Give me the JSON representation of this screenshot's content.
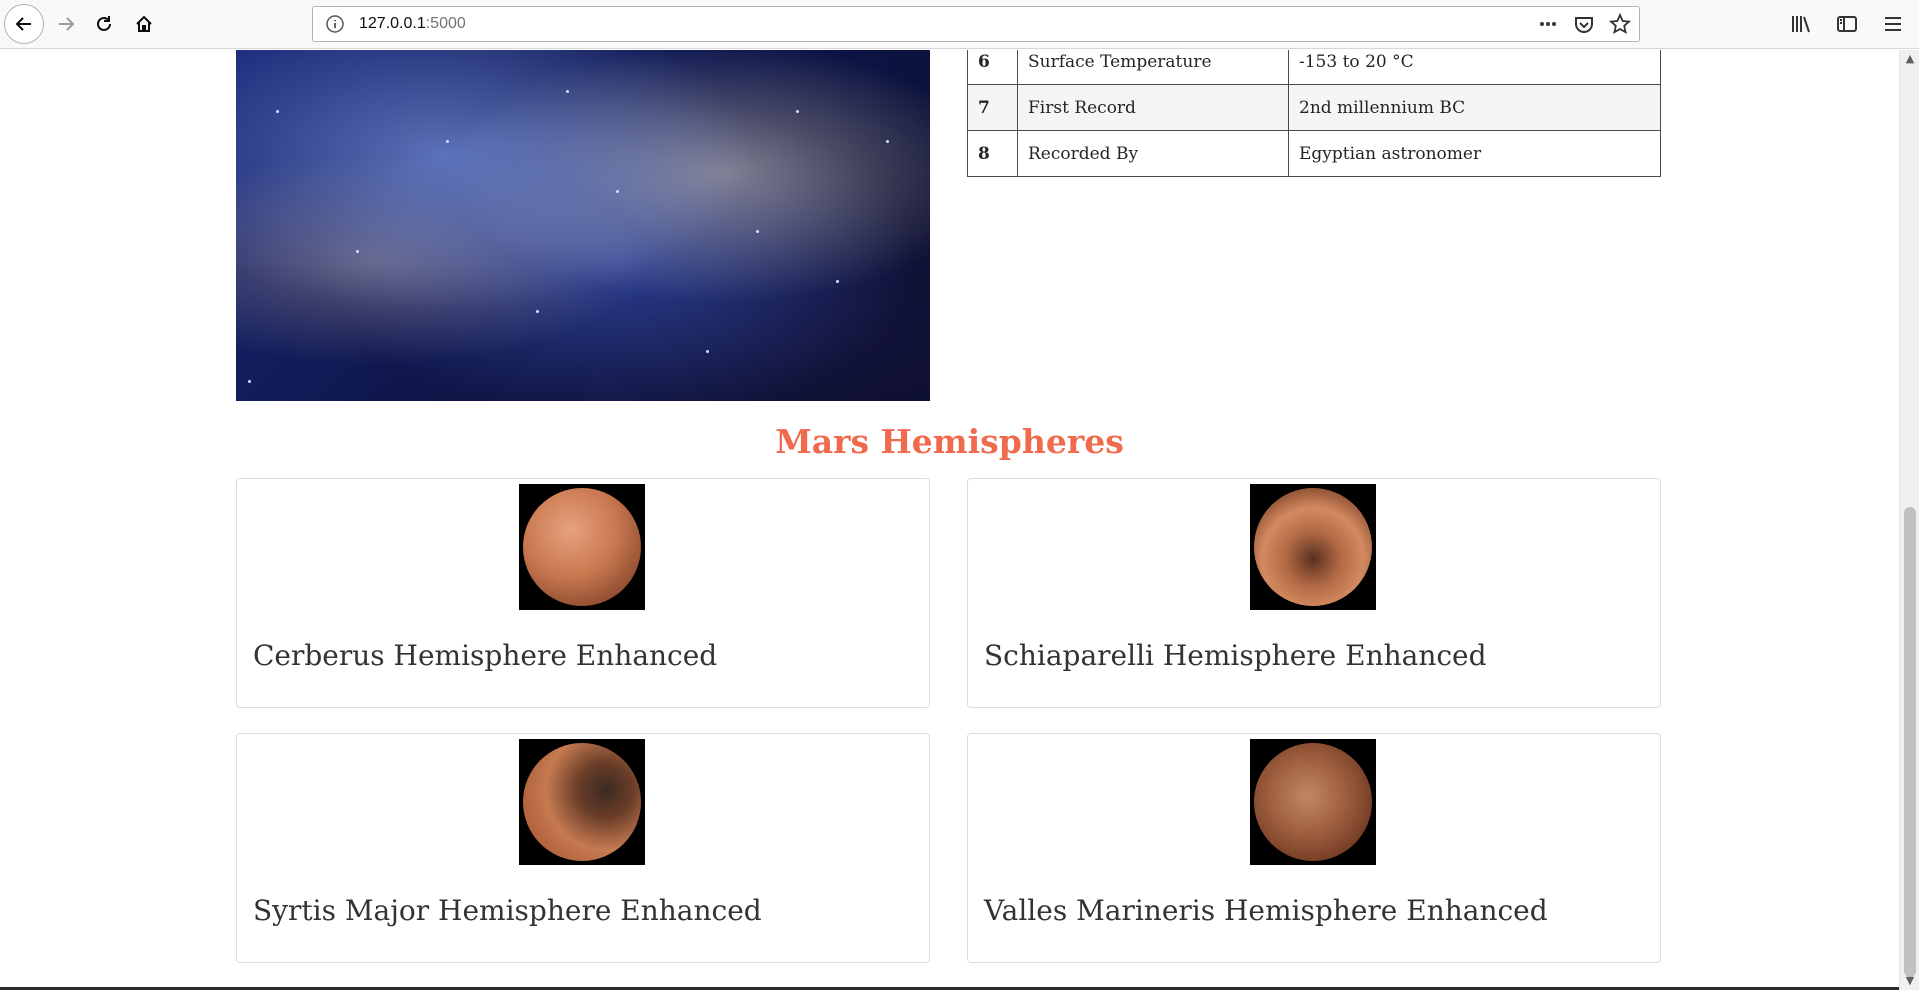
{
  "browser": {
    "url_host": "127.0.0.1",
    "url_port": ":5000"
  },
  "facts_table": {
    "rows": [
      {
        "index": "6",
        "key": "Surface Temperature",
        "value": "-153 to 20 °C"
      },
      {
        "index": "7",
        "key": "First Record",
        "value": "2nd millennium BC"
      },
      {
        "index": "8",
        "key": "Recorded By",
        "value": "Egyptian astronomer"
      }
    ]
  },
  "hemispheres": {
    "title": "Mars Hemispheres",
    "items": [
      {
        "title": "Cerberus Hemisphere Enhanced"
      },
      {
        "title": "Schiaparelli Hemisphere Enhanced"
      },
      {
        "title": "Syrtis Major Hemisphere Enhanced"
      },
      {
        "title": "Valles Marineris Hemisphere Enhanced"
      }
    ]
  },
  "colors": {
    "accent_title": "#f06a4e",
    "planet": "#c9784f"
  }
}
